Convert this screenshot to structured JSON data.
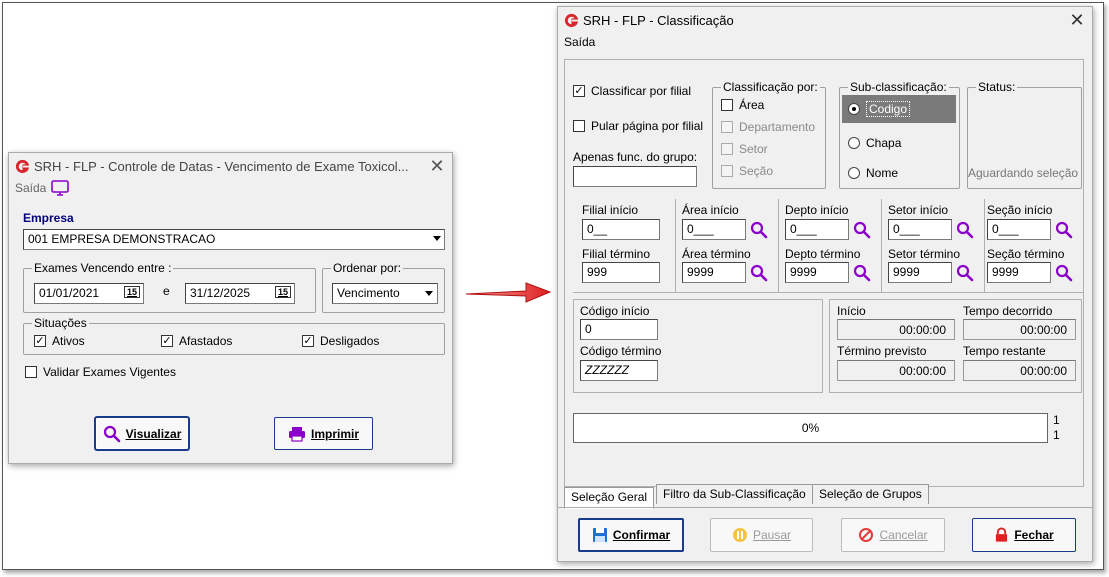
{
  "left_window": {
    "title": "SRH - FLP - Controle de Datas - Vencimento de Exame Toxicol...",
    "close": "✕",
    "menu_saida": "Saída",
    "empresa_label": "Empresa",
    "empresa_value": "001 EMPRESA DEMONSTRACAO",
    "exames_group": "Exames Vencendo entre :",
    "date_from": "01/01/2021",
    "date_sep": "e",
    "date_to": "31/12/2025",
    "cal_glyph": "15",
    "ordenar_group": "Ordenar por:",
    "ordenar_value": "Vencimento",
    "situacoes_group": "Situações",
    "ativos": "Ativos",
    "afastados": "Afastados",
    "desligados": "Desligados",
    "validar": "Validar Exames Vigentes",
    "visualizar": "Visualizar",
    "imprimir": "Imprimir"
  },
  "right_window": {
    "title": "SRH - FLP - Classificação",
    "close": "✕",
    "menu_saida": "Saída",
    "classificar_filial": "Classificar por filial",
    "pular_pagina": "Pular página por filial",
    "apenas_grupo": "Apenas func. do grupo:",
    "classificacao_group": "Classificação  por:",
    "area": "Área",
    "departamento": "Departamento",
    "setor": "Setor",
    "secao": "Seção",
    "subclass_group": "Sub-classificação:",
    "codigo": "Codigo",
    "chapa": "Chapa",
    "nome": "Nome",
    "status_group": "Status:",
    "aguardando": "Aguardando seleção",
    "filial_inicio": "Filial início",
    "filial_inicio_val": "0__",
    "filial_termino": "Filial término",
    "filial_termino_val": "999",
    "area_inicio": "Área início",
    "area_inicio_val": "0___",
    "area_termino": "Área término",
    "area_termino_val": "9999",
    "depto_inicio": "Depto início",
    "depto_inicio_val": "0___",
    "depto_termino": "Depto término",
    "depto_termino_val": "9999",
    "setor_inicio": "Setor início",
    "setor_inicio_val": "0___",
    "setor_termino": "Setor término",
    "setor_termino_val": "9999",
    "secao_inicio": "Seção início",
    "secao_inicio_val": "0___",
    "secao_termino": "Seção término",
    "secao_termino_val": "9999",
    "codigo_inicio": "Código início",
    "codigo_inicio_val": "0",
    "codigo_termino": "Código término",
    "codigo_termino_val": "ZZZZZZ",
    "inicio": "Início",
    "inicio_val": "00:00:00",
    "tempo_decorrido": "Tempo decorrido",
    "tempo_decorrido_val": "00:00:00",
    "termino_previsto": "Término previsto",
    "termino_previsto_val": "00:00:00",
    "tempo_restante": "Tempo restante",
    "tempo_restante_val": "00:00:00",
    "progress_text": "0%",
    "progress_percent": 0,
    "counter_top": "1",
    "counter_bottom": "1",
    "tabs": [
      "Seleção Geral",
      "Filtro da Sub-Classificação",
      "Seleção de Grupos"
    ],
    "confirmar": "Confirmar",
    "pausar": "Pausar",
    "cancelar": "Cancelar",
    "fechar": "Fechar"
  },
  "colors": {
    "accent_blue": "#1a3a8a",
    "label_navy": "#000080",
    "logo_red": "#d9262c",
    "selection_gray": "#7a7a7a",
    "magnifier_purple": "#8a00c8",
    "arrow_red": "#e02020"
  }
}
